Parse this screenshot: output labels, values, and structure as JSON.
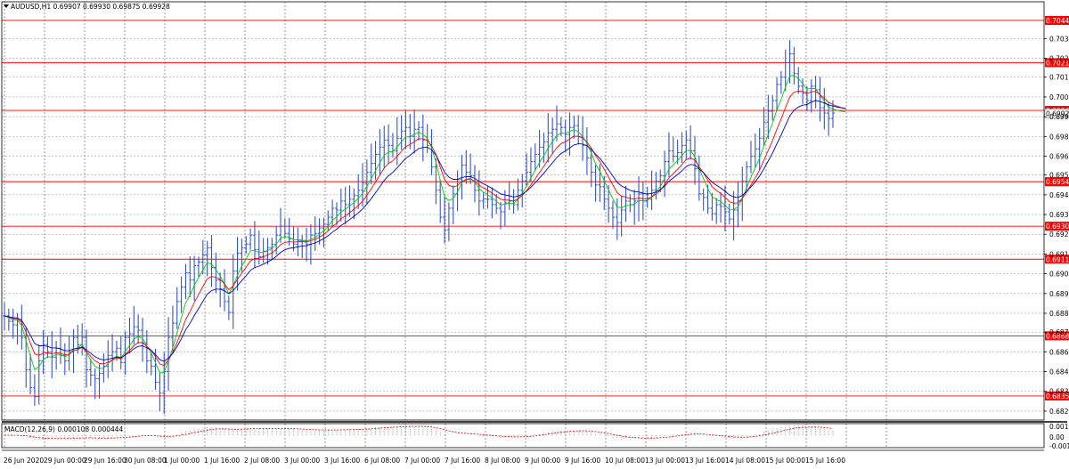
{
  "chart_data": {
    "type": "candlestick",
    "symbol_header": "AUDUSD,H1  0.69907 0.69930 0.69875 0.69928",
    "indicator_label": "MACD(12,26,9) 0.000108 0.000444",
    "price_axis_ticks": [
      "0.70345",
      "0.70235",
      "0.70130",
      "0.70020",
      "0.69910",
      "0.69800",
      "0.69690",
      "0.69585",
      "0.69475",
      "0.69365",
      "0.69255",
      "0.69145",
      "0.69035",
      "0.68925",
      "0.68815",
      "0.68710",
      "0.68600",
      "0.68490",
      "0.68380",
      "0.68270"
    ],
    "indicator_axis_ticks": [
      "0.001567",
      "0.00",
      "-0.001478"
    ],
    "time_axis_ticks": [
      "26 Jun 2020",
      "29 Jun 00:00",
      "29 Jun 16:00",
      "30 Jun 08:00",
      "1 Jul 00:00",
      "1 Jul 16:00",
      "2 Jul 08:00",
      "3 Jul 00:00",
      "3 Jul 16:00",
      "6 Jul 08:00",
      "7 Jul 00:00",
      "7 Jul 16:00",
      "8 Jul 08:00",
      "9 Jul 00:00",
      "9 Jul 16:00",
      "10 Jul 08:00",
      "13 Jul 00:00",
      "13 Jul 16:00",
      "14 Jul 08:00",
      "15 Jul 00:00",
      "15 Jul 16:00"
    ],
    "horizontal_levels": [
      {
        "value": "0.70446",
        "color": "#ff0000"
      },
      {
        "value": "0.70211",
        "color": "#ff0000"
      },
      {
        "value": "0.69945",
        "color": "#ff0000"
      },
      {
        "value": "0.69548",
        "color": "#ff0000"
      },
      {
        "value": "0.69300",
        "color": "#ff0000"
      },
      {
        "value": "0.69116",
        "color": "#ff0000"
      },
      {
        "value": "0.68689",
        "color": "#ff0000"
      },
      {
        "value": "0.68354",
        "color": "#ff0000"
      }
    ],
    "current_price": "0.69928",
    "price_range": [
      0.6822,
      0.7055
    ],
    "grid": true,
    "series": [
      {
        "kind": "bars",
        "color": "#3355cc",
        "close": [
          0.688,
          0.6877,
          0.6875,
          0.6878,
          0.6868,
          0.685,
          0.684,
          0.6835,
          0.6855,
          0.6864,
          0.686,
          0.6857,
          0.6862,
          0.6858,
          0.6855,
          0.686,
          0.6868,
          0.6864,
          0.6868,
          0.685,
          0.6847,
          0.6845,
          0.6848,
          0.6852,
          0.6858,
          0.686,
          0.6862,
          0.6854,
          0.6868,
          0.687,
          0.6874,
          0.6872,
          0.6865,
          0.6855,
          0.6852,
          0.6843,
          0.6837,
          0.6849,
          0.6868,
          0.6876,
          0.6888,
          0.6896,
          0.6904,
          0.69,
          0.6908,
          0.691,
          0.6914,
          0.6918,
          0.6907,
          0.69,
          0.6895,
          0.6888,
          0.6882,
          0.6905,
          0.6915,
          0.6918,
          0.692,
          0.6925,
          0.6917,
          0.6913,
          0.6916,
          0.6918,
          0.692,
          0.6925,
          0.693,
          0.6926,
          0.6923,
          0.692,
          0.6922,
          0.6922,
          0.692,
          0.6925,
          0.6926,
          0.6929,
          0.6931,
          0.6935,
          0.694,
          0.6939,
          0.6944,
          0.6942,
          0.6945,
          0.6947,
          0.695,
          0.6954,
          0.696,
          0.6965,
          0.697,
          0.6974,
          0.6978,
          0.6975,
          0.6972,
          0.6979,
          0.6983,
          0.6985,
          0.698,
          0.6984,
          0.6985,
          0.6978,
          0.6975,
          0.6963,
          0.695,
          0.6935,
          0.6928,
          0.694,
          0.6948,
          0.6956,
          0.6964,
          0.696,
          0.6958,
          0.695,
          0.6944,
          0.6945,
          0.6945,
          0.6942,
          0.694,
          0.6938,
          0.6943,
          0.6944,
          0.6942,
          0.695,
          0.6955,
          0.696,
          0.6966,
          0.697,
          0.6974,
          0.6977,
          0.6982,
          0.6984,
          0.6987,
          0.6985,
          0.6981,
          0.6985,
          0.6986,
          0.698,
          0.6975,
          0.6968,
          0.696,
          0.6953,
          0.6952,
          0.6945,
          0.694,
          0.6935,
          0.6932,
          0.6939,
          0.6944,
          0.6942,
          0.6944,
          0.6948,
          0.6944,
          0.6945,
          0.695,
          0.6955,
          0.6958,
          0.6966,
          0.6972,
          0.6969,
          0.6971,
          0.6975,
          0.6978,
          0.6972,
          0.6962,
          0.6948,
          0.6946,
          0.694,
          0.6937,
          0.6942,
          0.6941,
          0.6938,
          0.6934,
          0.6939,
          0.6944,
          0.6955,
          0.6963,
          0.6969,
          0.6973,
          0.6979,
          0.6988,
          0.6994,
          0.7,
          0.7009,
          0.7013,
          0.7021,
          0.7026,
          0.7015,
          0.7008,
          0.7004,
          0.7,
          0.7008,
          0.7006,
          0.6996,
          0.6993,
          0.699,
          0.6993
        ]
      },
      {
        "kind": "line",
        "name": "",
        "color": "#00cc00",
        "period": 5
      },
      {
        "kind": "line",
        "name": "",
        "color": "#ff0000",
        "period": 9
      },
      {
        "kind": "line",
        "name": "",
        "color": "#0000cc",
        "period": 14
      }
    ],
    "macd_color": "#cc0000"
  }
}
